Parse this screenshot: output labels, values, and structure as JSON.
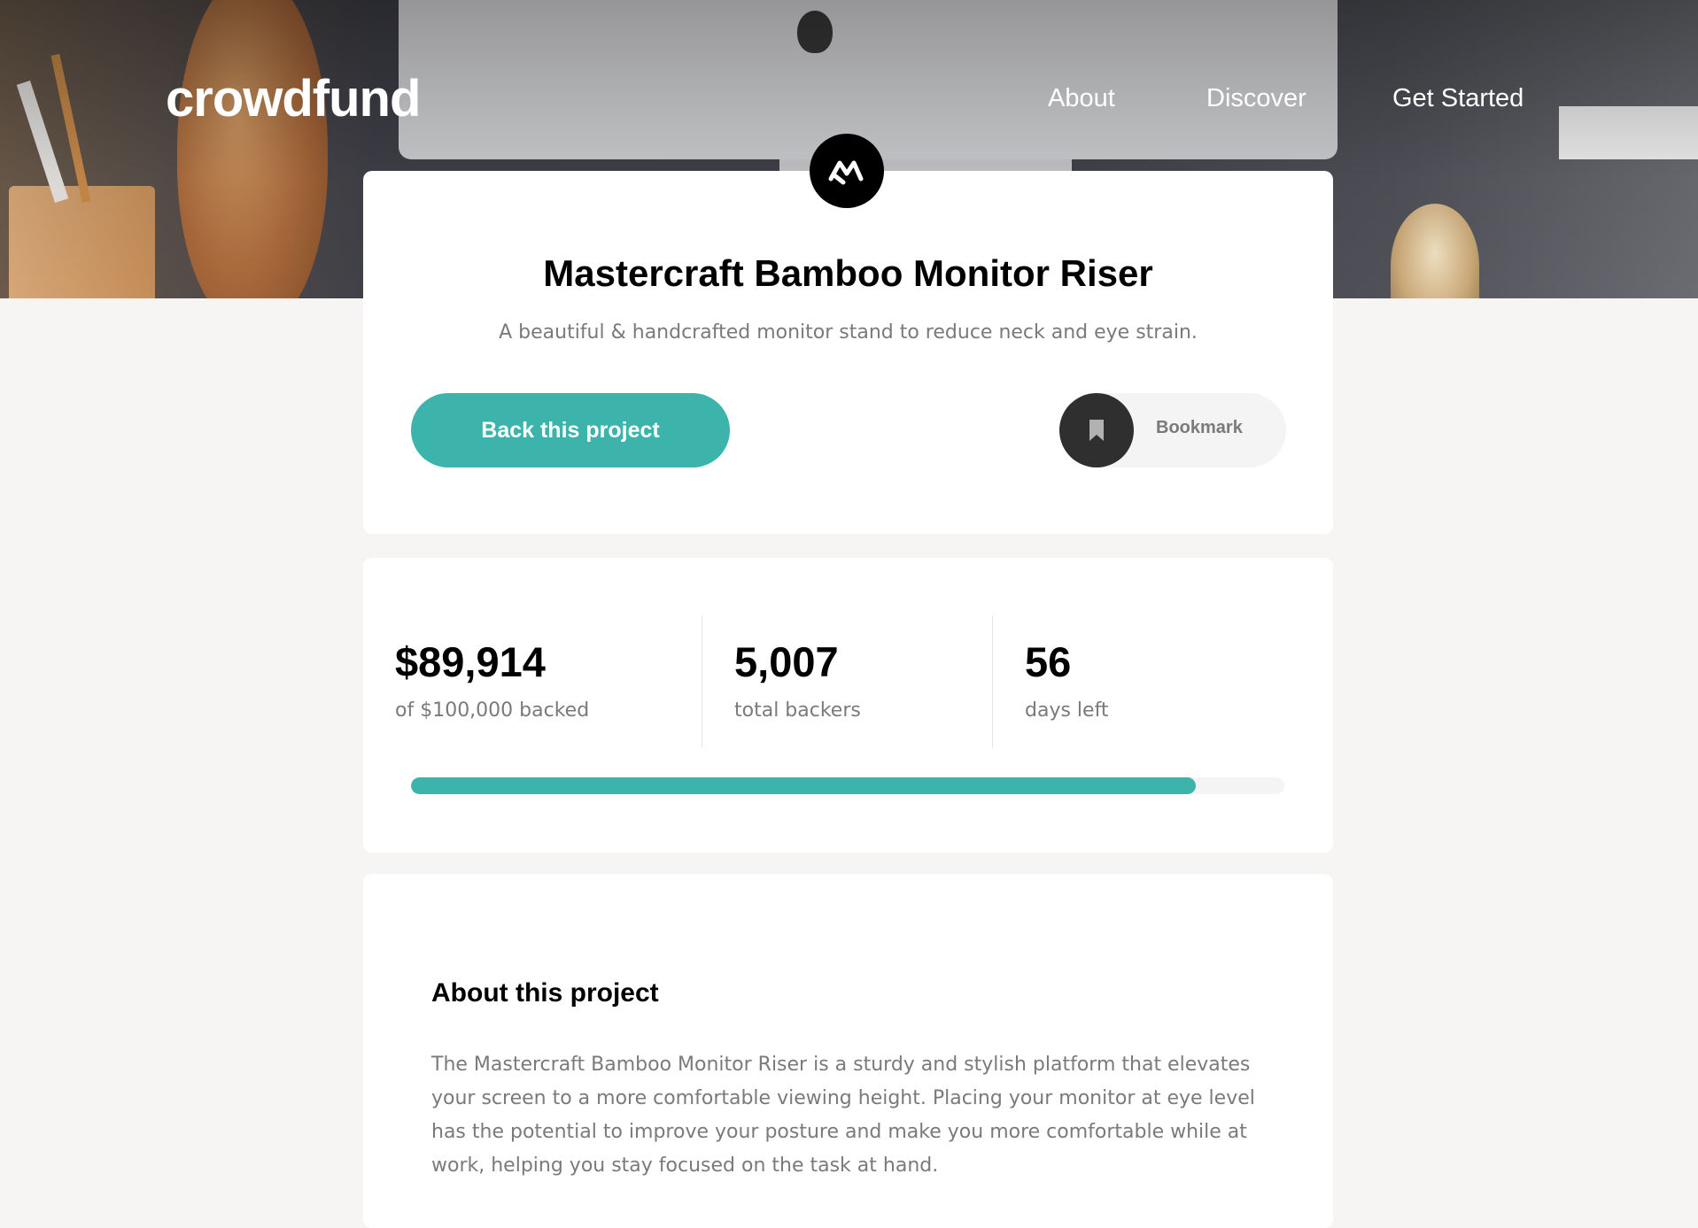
{
  "header": {
    "logo": "crowdfund",
    "nav": [
      "About",
      "Discover",
      "Get Started"
    ]
  },
  "project": {
    "title": "Mastercraft Bamboo Monitor Riser",
    "subtitle": "A beautiful & handcrafted monitor stand to reduce neck and eye strain.",
    "back_label": "Back this project",
    "bookmark_label": "Bookmark"
  },
  "stats": {
    "backed": {
      "value": "$89,914",
      "label": "of $100,000 backed"
    },
    "backers": {
      "value": "5,007",
      "label": "total backers"
    },
    "days": {
      "value": "56",
      "label": "days left"
    },
    "progress_fraction": 0.899
  },
  "about": {
    "title": "About this project",
    "body": "The Mastercraft Bamboo Monitor Riser is a sturdy and stylish platform that elevates your screen to a more comfortable viewing height. Placing your monitor at eye level has the potential to improve your posture and make you more comfortable while at work, helping you stay focused on the task at hand."
  },
  "colors": {
    "accent": "#3cb3ab",
    "dark": "#2f2f2f",
    "muted_text": "#7a7a7a",
    "background": "#f6f5f3"
  },
  "icons": {
    "project_logo": "mastercraft-logo-icon",
    "bookmark": "bookmark-icon"
  }
}
